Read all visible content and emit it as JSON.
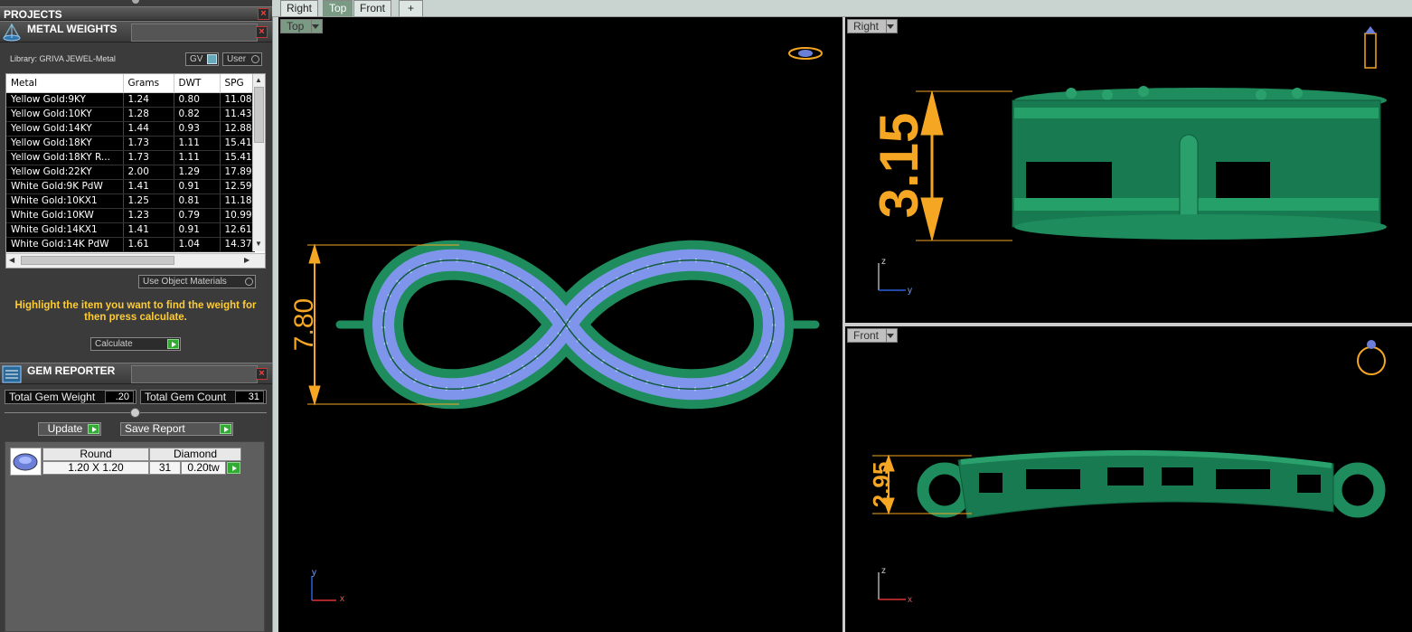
{
  "projects": {
    "title": "PROJECTS"
  },
  "metal_weights": {
    "title": "METAL WEIGHTS",
    "library": "Library: GRIVA JEWEL-Metal",
    "gv_label": "GV",
    "user_label": "User",
    "columns": [
      "Metal",
      "Grams",
      "DWT",
      "SPG"
    ],
    "rows": [
      [
        "Yellow Gold:9KY",
        "1.24",
        "0.80",
        "11.08"
      ],
      [
        "Yellow Gold:10KY",
        "1.28",
        "0.82",
        "11.43"
      ],
      [
        "Yellow Gold:14KY",
        "1.44",
        "0.93",
        "12.88"
      ],
      [
        "Yellow Gold:18KY",
        "1.73",
        "1.11",
        "15.41"
      ],
      [
        "Yellow Gold:18KY R...",
        "1.73",
        "1.11",
        "15.41"
      ],
      [
        "Yellow Gold:22KY",
        "2.00",
        "1.29",
        "17.89"
      ],
      [
        "White Gold:9K PdW",
        "1.41",
        "0.91",
        "12.59"
      ],
      [
        "White Gold:10KX1",
        "1.25",
        "0.81",
        "11.18"
      ],
      [
        "White Gold:10KW",
        "1.23",
        "0.79",
        "10.99"
      ],
      [
        "White Gold:14KX1",
        "1.41",
        "0.91",
        "12.61"
      ],
      [
        "White Gold:14K PdW",
        "1.61",
        "1.04",
        "14.37"
      ]
    ],
    "use_object_materials": "Use Object Materials",
    "instruction": "Highlight the item you want to find the weight for then press calculate.",
    "calculate_label": "Calculate"
  },
  "gem_reporter": {
    "title": "GEM REPORTER",
    "total_weight_label": "Total Gem Weight",
    "total_weight_value": ".20",
    "total_count_label": "Total Gem Count",
    "total_count_value": "31",
    "update_label": "Update",
    "save_report_label": "Save Report",
    "columns": [
      "Round",
      "Diamond"
    ],
    "row": {
      "size": "1.20 X 1.20",
      "count": "31",
      "weight": "0.20tw"
    }
  },
  "tabs": [
    "Right",
    "Top",
    "Front"
  ],
  "add_tab_symbol": "+",
  "active_tab": "Top",
  "viewports": {
    "top": {
      "label": "Top",
      "dimension": "7.80",
      "axis_y": "y",
      "axis_x": "x"
    },
    "right": {
      "label": "Right",
      "dimension": "3.15",
      "axis_z": "z",
      "axis_y": "y"
    },
    "front": {
      "label": "Front",
      "dimension": "2.95",
      "axis_z": "z",
      "axis_x": "x"
    }
  },
  "colors": {
    "metal_green": "#1e8c5c",
    "gem_blue": "#8fa8ff",
    "dimension_orange": "#f5a623",
    "panel_bg": "#3b3b3b",
    "instruction_yellow": "#ffcc33"
  }
}
